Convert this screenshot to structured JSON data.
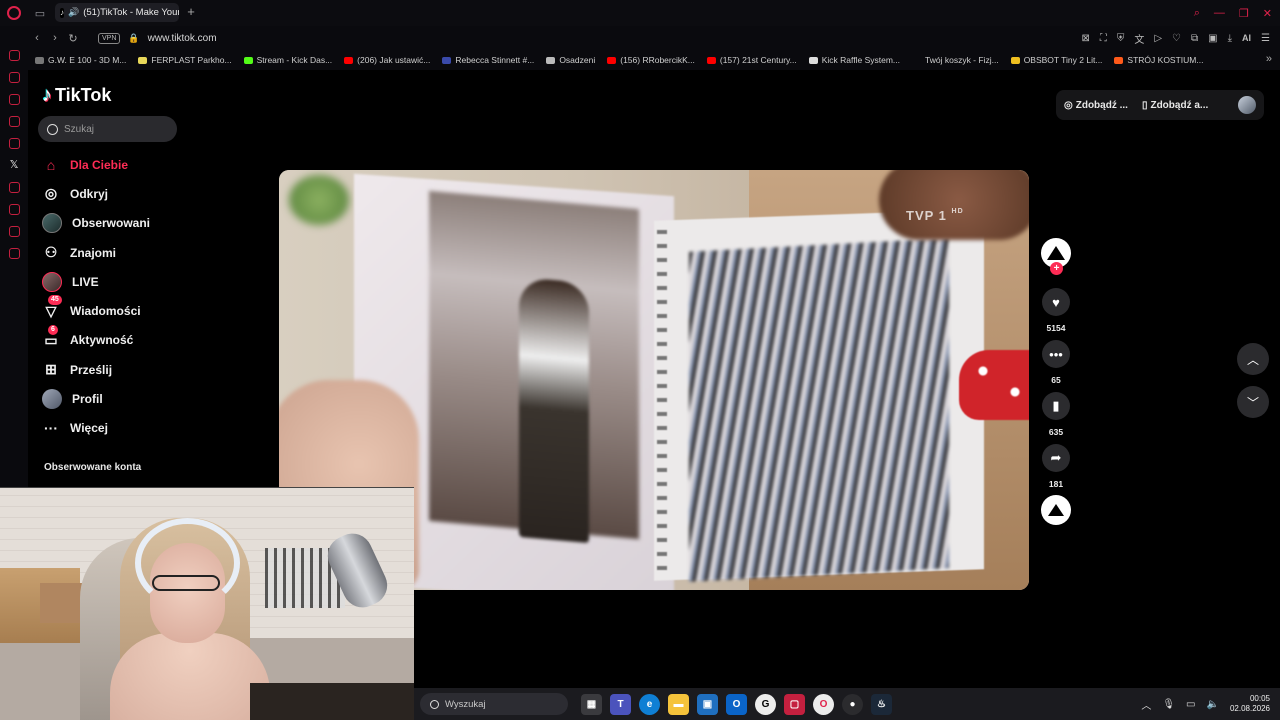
{
  "browser": {
    "tab_title": "(51)TikTok - Make Your",
    "new_tab": "+",
    "vpn_label": "VPN",
    "url": "www.tiktok.com",
    "ai_label": "AI",
    "accent": "#e0224b"
  },
  "bookmarks": [
    {
      "label": "G.W. E 100 - 3D M...",
      "color": "#777777"
    },
    {
      "label": "FERPLAST Parkho...",
      "color": "#e8d85a"
    },
    {
      "label": "Stream - Kick Das...",
      "color": "#53fc18"
    },
    {
      "label": "(206) Jak ustawić...",
      "color": "#ff0000"
    },
    {
      "label": "Rebecca Stinnett #...",
      "color": "#3a4aaa"
    },
    {
      "label": "Osadzeni",
      "color": "#bbbbbb"
    },
    {
      "label": "(156) RRobercikK...",
      "color": "#ff0000"
    },
    {
      "label": "(157) 21st Century...",
      "color": "#ff0000"
    },
    {
      "label": "Kick Raffle System...",
      "color": "#dddddd"
    },
    {
      "label": "Twój koszyk - Fizj...",
      "color": "#0a0a0e"
    },
    {
      "label": "OBSBOT Tiny 2 Lit...",
      "color": "#f0c020"
    },
    {
      "label": "STRÓJ KOSTIUM...",
      "color": "#ff5a1a"
    }
  ],
  "tiktok": {
    "logo_text": "TikTok",
    "search_placeholder": "Szukaj",
    "menu": [
      {
        "label": "Dla Ciebie",
        "icon": "home-icon",
        "active": true
      },
      {
        "label": "Odkryj",
        "icon": "compass-icon"
      },
      {
        "label": "Obserwowani",
        "icon": "following-avatar-icon"
      },
      {
        "label": "Znajomi",
        "icon": "friends-icon"
      },
      {
        "label": "LIVE",
        "icon": "live-avatar-icon"
      },
      {
        "label": "Wiadomości",
        "icon": "messages-icon",
        "badge": "45"
      },
      {
        "label": "Aktywność",
        "icon": "activity-icon",
        "badge": "6"
      },
      {
        "label": "Prześlij",
        "icon": "upload-icon"
      },
      {
        "label": "Profil",
        "icon": "profile-avatar-icon"
      },
      {
        "label": "Więcej",
        "icon": "more-icon"
      }
    ],
    "following_accounts_title": "Obserwowane konta",
    "header": {
      "get_coins": "Zdobądź ...",
      "get_app": "Zdobądź a..."
    },
    "video": {
      "watermark": "TVP 1",
      "watermark_hd": "HD"
    },
    "actions": {
      "likes": "5154",
      "comments": "65",
      "saves": "635",
      "shares": "181"
    },
    "brand_color": "#fe2c55"
  },
  "taskbar": {
    "search_placeholder": "Wyszukaj",
    "time": "00:05",
    "date": "02.08.2026"
  }
}
